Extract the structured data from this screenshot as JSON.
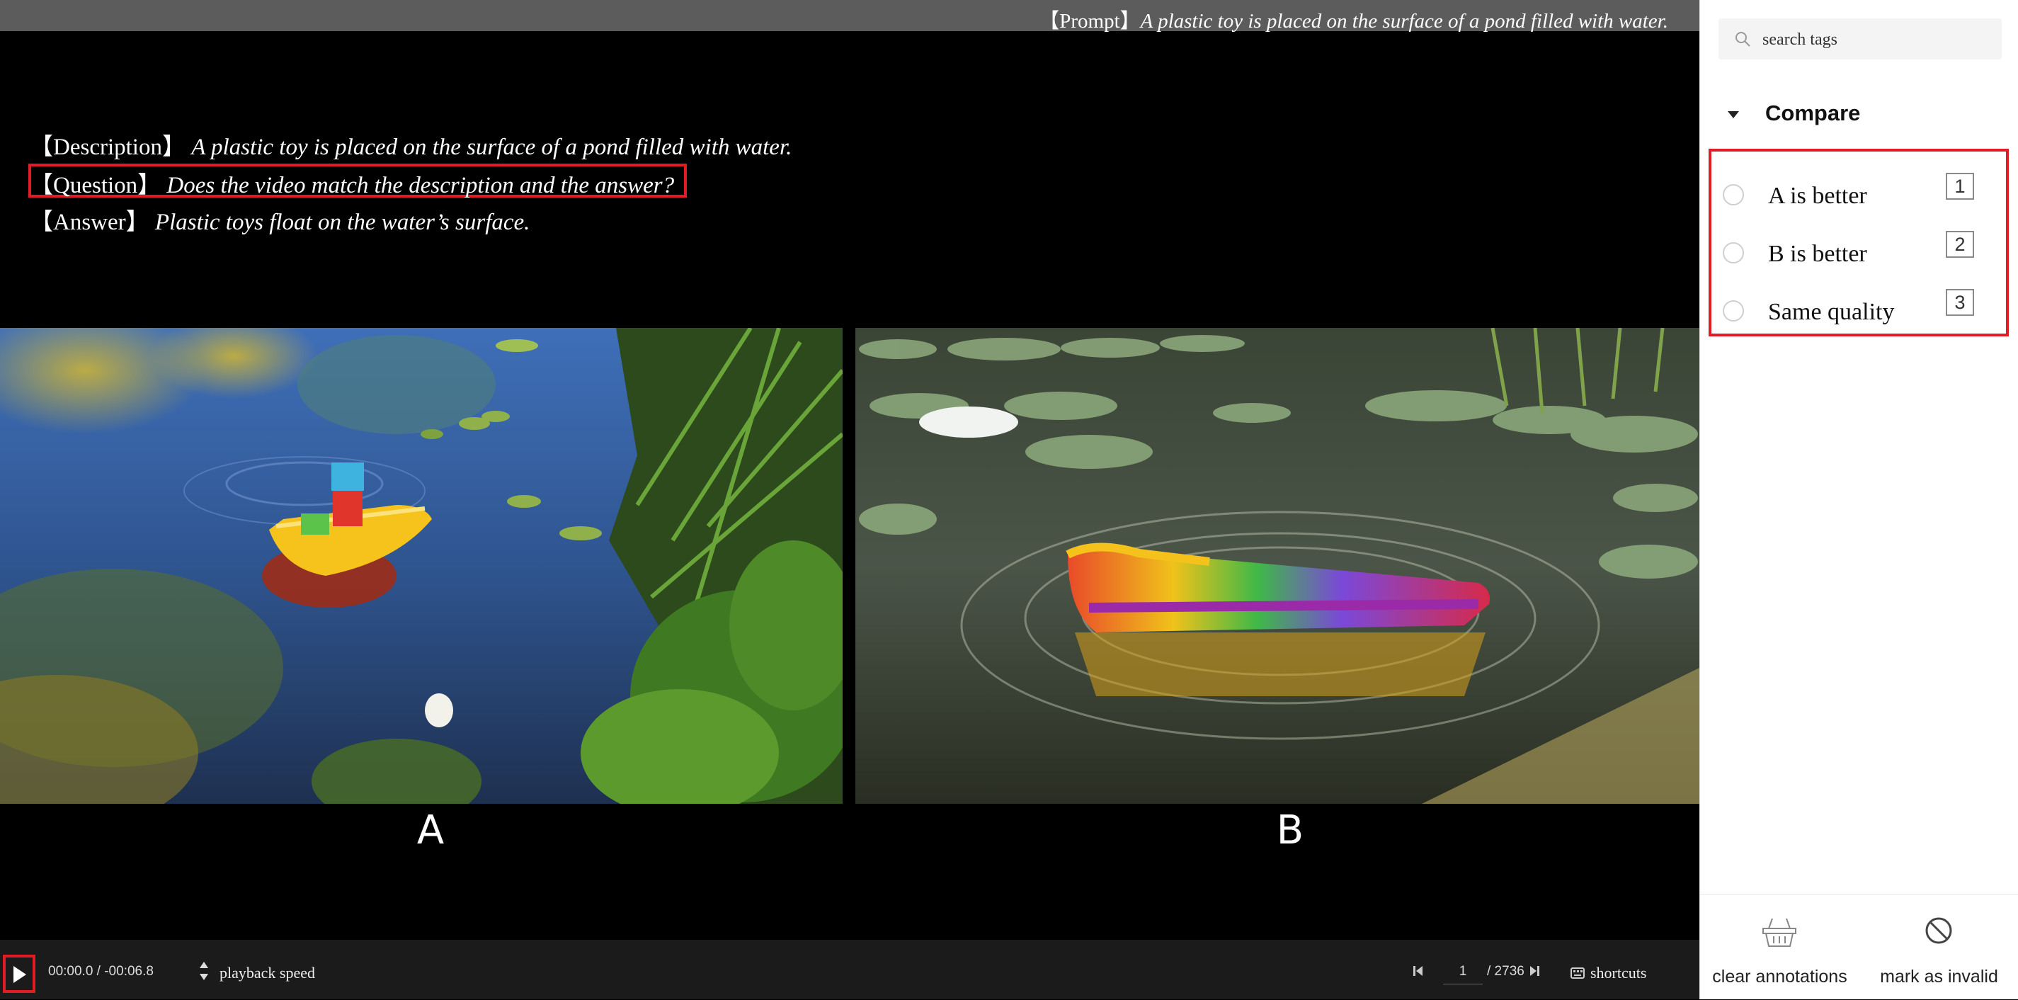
{
  "prompt": {
    "label": "【Prompt】",
    "text": "A plastic toy is placed on the surface of a pond filled with water."
  },
  "info": {
    "description": {
      "label": "【Description】",
      "text": "A plastic toy is placed on the surface of a pond filled with water."
    },
    "question": {
      "label": "【Question】",
      "text": "Does the video match the description and the answer?"
    },
    "answer": {
      "label": "【Answer】",
      "text": "Plastic toys float on the water’s surface."
    }
  },
  "videos": [
    {
      "label": "A"
    },
    {
      "label": "B"
    }
  ],
  "controls": {
    "time": "00:00.0 / -00:06.8",
    "playback_speed_label": "playback speed",
    "page_current": "1",
    "page_total": "/ 2736",
    "shortcuts_label": "shortcuts",
    "play_icon": "play-icon"
  },
  "panel": {
    "search_placeholder": "search tags",
    "group_title": "Compare",
    "options": [
      {
        "label": "A is better",
        "key": "1"
      },
      {
        "label": "B is better",
        "key": "2"
      },
      {
        "label": "Same quality",
        "key": "3"
      }
    ],
    "footer": {
      "clear_label": "clear annotations",
      "invalid_label": "mark as invalid"
    }
  },
  "colors": {
    "highlight": "#e01d24",
    "panel_bg": "#ffffff",
    "viewer_bg": "#000000",
    "prompt_bar": "#5c5c5c"
  }
}
